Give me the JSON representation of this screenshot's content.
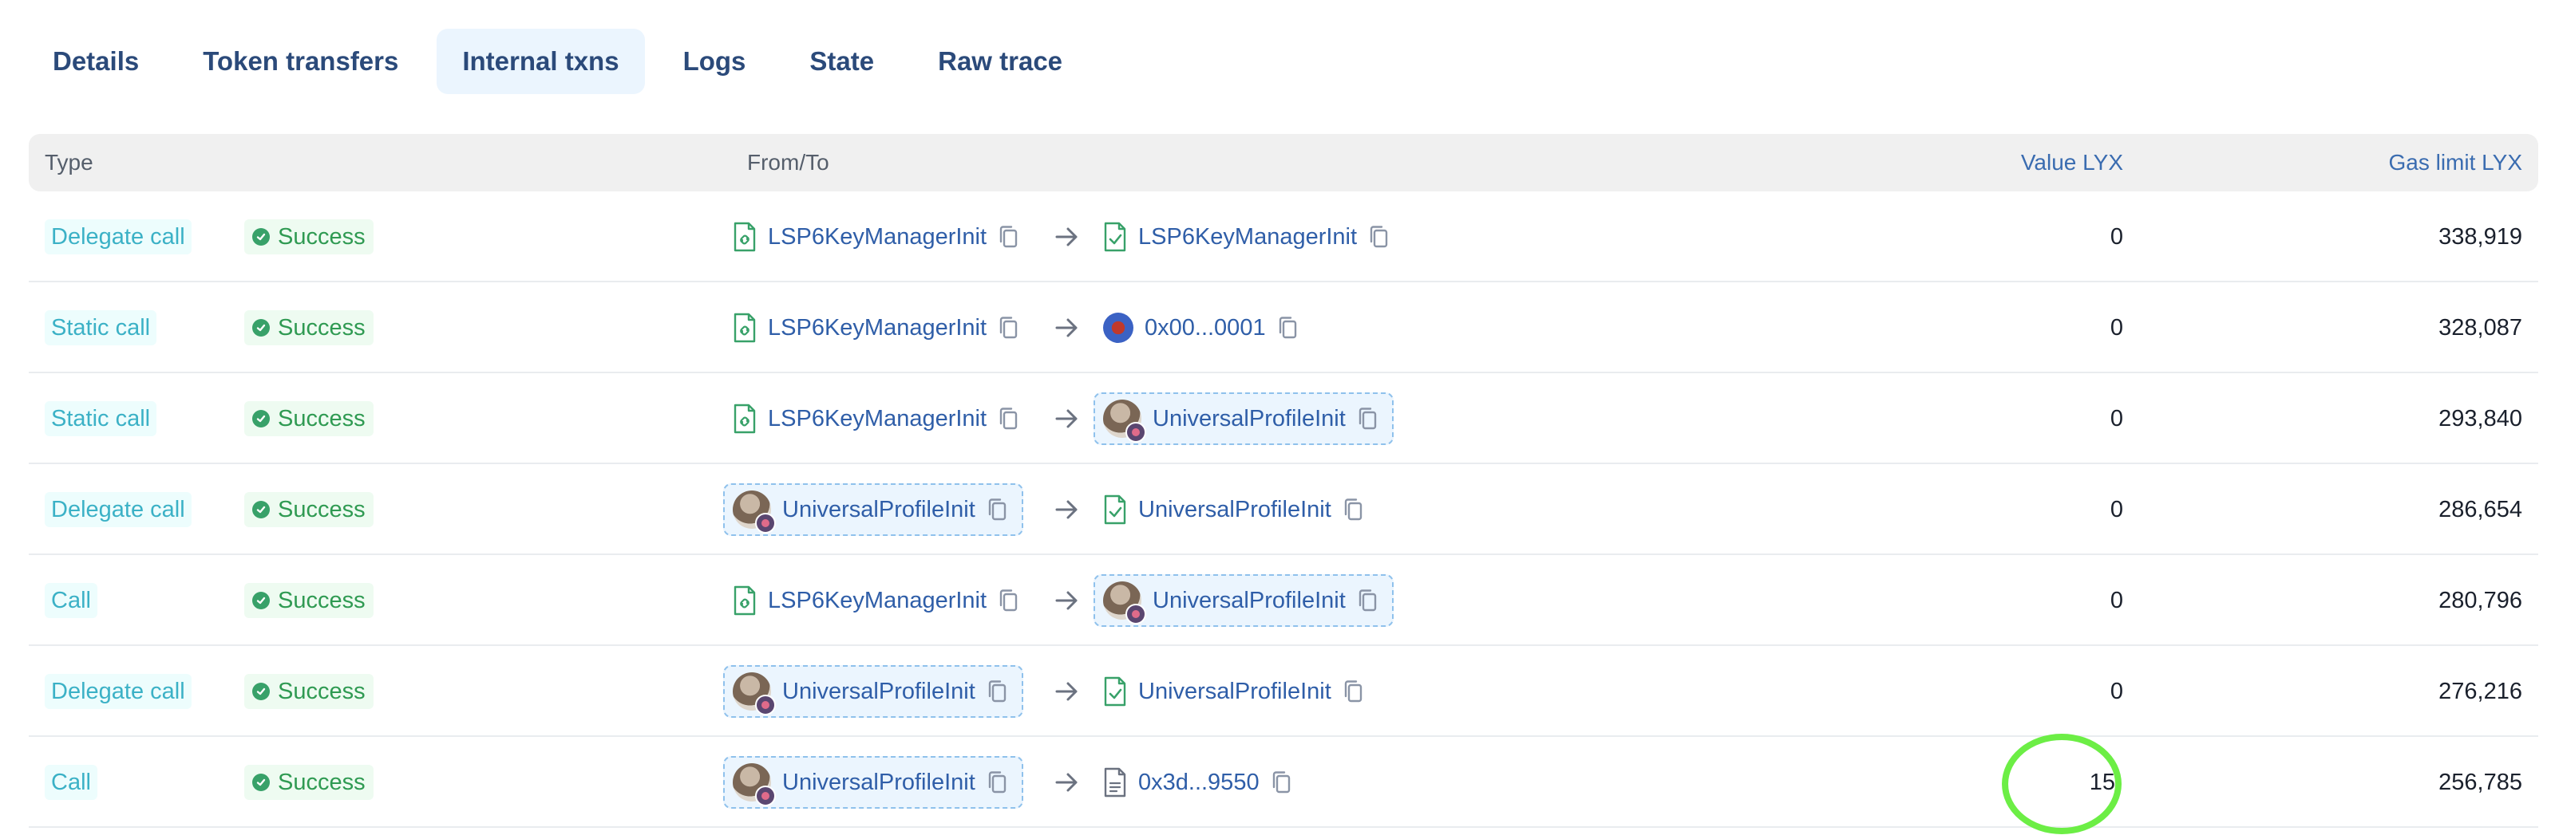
{
  "tabs": [
    {
      "label": "Details",
      "active": false
    },
    {
      "label": "Token transfers",
      "active": false
    },
    {
      "label": "Internal txns",
      "active": true
    },
    {
      "label": "Logs",
      "active": false
    },
    {
      "label": "State",
      "active": false
    },
    {
      "label": "Raw trace",
      "active": false
    }
  ],
  "table": {
    "headers": {
      "type": "Type",
      "from_to": "From/To",
      "value": "Value LYX",
      "gas": "Gas limit LYX"
    },
    "rows": [
      {
        "type": "Delegate call",
        "status": "Success",
        "from": "LSP6KeyManagerInit",
        "to": "LSP6KeyManagerInit",
        "value": "0",
        "gas": "338,919"
      },
      {
        "type": "Static call",
        "status": "Success",
        "from": "LSP6KeyManagerInit",
        "to": "0x00...0001",
        "value": "0",
        "gas": "328,087"
      },
      {
        "type": "Static call",
        "status": "Success",
        "from": "LSP6KeyManagerInit",
        "to": "UniversalProfileInit",
        "value": "0",
        "gas": "293,840"
      },
      {
        "type": "Delegate call",
        "status": "Success",
        "from": "UniversalProfileInit",
        "to": "UniversalProfileInit",
        "value": "0",
        "gas": "286,654"
      },
      {
        "type": "Call",
        "status": "Success",
        "from": "LSP6KeyManagerInit",
        "to": "UniversalProfileInit",
        "value": "0",
        "gas": "280,796"
      },
      {
        "type": "Delegate call",
        "status": "Success",
        "from": "UniversalProfileInit",
        "to": "UniversalProfileInit",
        "value": "0",
        "gas": "276,216"
      },
      {
        "type": "Call",
        "status": "Success",
        "from": "UniversalProfileInit",
        "to": "0x3d...9550",
        "value": "15",
        "gas": "256,785"
      }
    ]
  },
  "colors": {
    "accent": "#2f5ea8",
    "type_badge": "#3bb1c6",
    "success": "#38a169",
    "annotation_circle": "#6cee45"
  },
  "icons": [
    "contract-icon",
    "verified-contract-icon",
    "copy-icon",
    "arrow-right-icon",
    "check-circle-icon",
    "document-icon",
    "avatar"
  ]
}
